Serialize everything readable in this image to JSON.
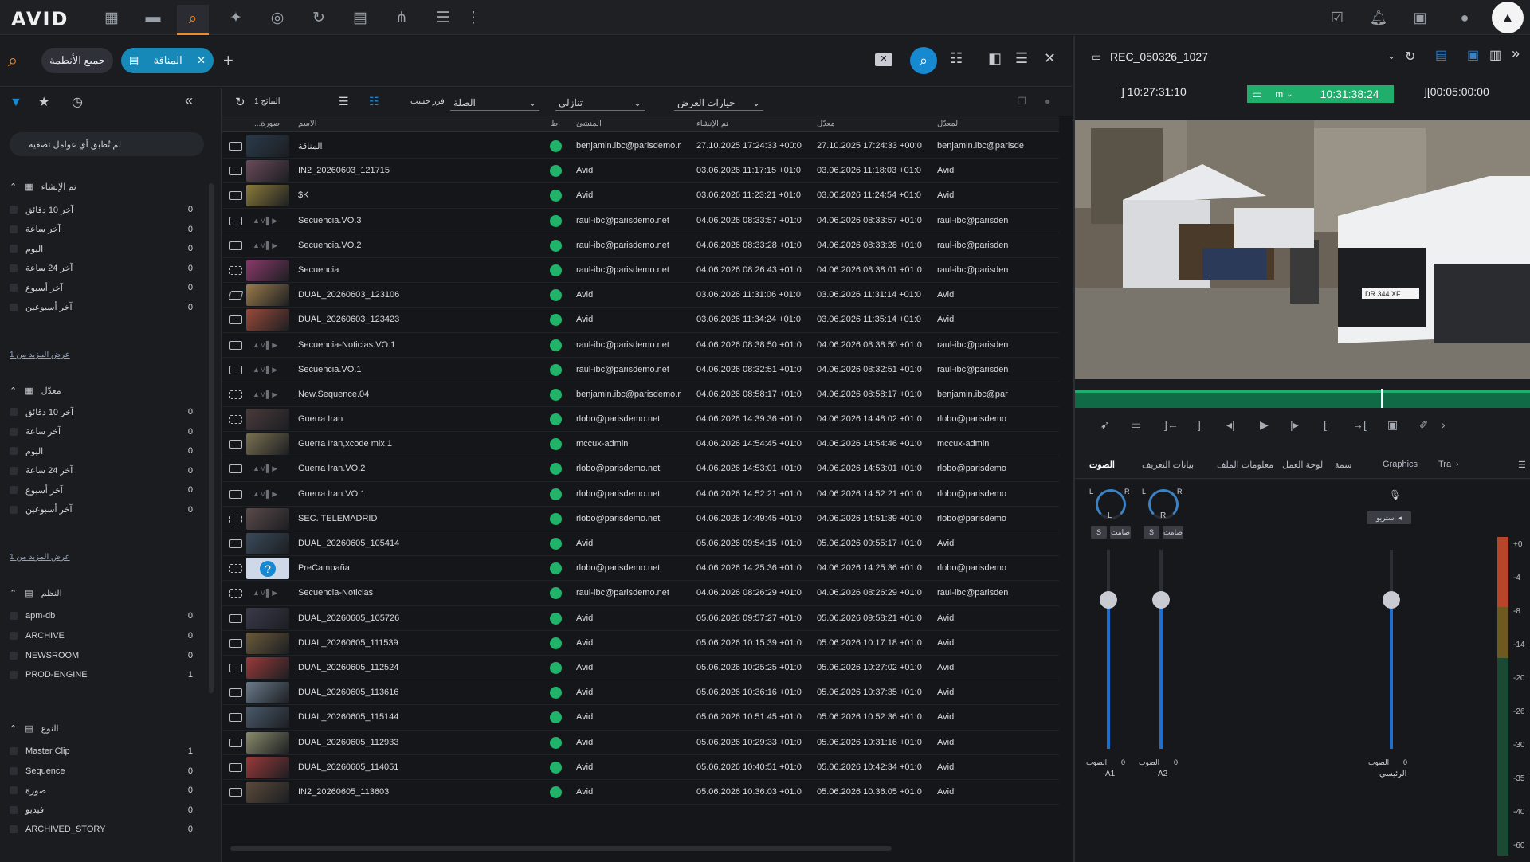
{
  "topbar": {
    "logo": "AVID",
    "icons": [
      "grid-icon",
      "folder-icon",
      "search-icon",
      "pin-icon",
      "target-icon",
      "refresh-icon",
      "tasks-icon",
      "share-icon",
      "list-icon",
      "more-icon"
    ],
    "right_icons": [
      "check-icon",
      "bell-icon",
      "inbox-icon",
      "user-icon"
    ]
  },
  "search": {
    "all_systems": "جميع الأنظمة",
    "tab_label": "المناقة"
  },
  "filters": {
    "no_filter": "لم تُطبق أي عوامل تصفية",
    "created_header": "تم الإنشاء",
    "modified_header": "معدّل",
    "systems_header": "النظم",
    "type_header": "النوع",
    "more_link": "عرض المزيد من 1",
    "created": [
      {
        "label": "آخر 10 دقائق",
        "count": "0"
      },
      {
        "label": "آخر ساعة",
        "count": "0"
      },
      {
        "label": "اليوم",
        "count": "0"
      },
      {
        "label": "آخر 24 ساعة",
        "count": "0"
      },
      {
        "label": "آخر أسبوع",
        "count": "0"
      },
      {
        "label": "آخر أسبوعين",
        "count": "0"
      }
    ],
    "modified": [
      {
        "label": "آخر 10 دقائق",
        "count": "0"
      },
      {
        "label": "آخر ساعة",
        "count": "0"
      },
      {
        "label": "اليوم",
        "count": "0"
      },
      {
        "label": "آخر 24 ساعة",
        "count": "0"
      },
      {
        "label": "آخر أسبوع",
        "count": "0"
      },
      {
        "label": "آخر أسبوعين",
        "count": "0"
      }
    ],
    "systems": [
      {
        "label": "apm-db",
        "count": "0"
      },
      {
        "label": "ARCHIVE",
        "count": "0"
      },
      {
        "label": "NEWSROOM",
        "count": "0"
      },
      {
        "label": "PROD-ENGINE",
        "count": "1"
      }
    ],
    "types": [
      {
        "label": "Master Clip",
        "count": "1"
      },
      {
        "label": "Sequence",
        "count": "0"
      },
      {
        "label": "صورة",
        "count": "0"
      },
      {
        "label": "فيديو",
        "count": "0"
      },
      {
        "label": "ARCHIVED_STORY",
        "count": "0"
      }
    ]
  },
  "results": {
    "count_label": "1 النتائج",
    "sort_by": "فرز حسب",
    "sort_field": "الصلة",
    "order": "تنازلي",
    "view_options": "خيارات العرض",
    "columns": {
      "frames": "...صورة",
      "name": "الاسم",
      "st": "ط.",
      "creator": "المنشئ",
      "created": "تم الإنشاء",
      "modified": "معدّل",
      "modifier": "المعدّل"
    },
    "rows": [
      {
        "type": "clip",
        "thumb": "#2a3a4a",
        "name": "المناقة",
        "creator": "benjamin.ibc@parisdemo.r",
        "created": "27.10.2025 17:24:33 +00:0",
        "modified": "27.10.2025 17:24:33 +00:0",
        "modifier": "benjamin.ibc@parisde"
      },
      {
        "type": "clip",
        "thumb": "#6a4a5a",
        "name": "IN2_20260603_121715",
        "creator": "Avid",
        "created": "03.06.2026 11:17:15 +01:0",
        "modified": "03.06.2026 11:18:03 +01:0",
        "modifier": "Avid"
      },
      {
        "type": "clip",
        "thumb": "#8a7a3a",
        "name": "$K",
        "creator": "Avid",
        "created": "03.06.2026 11:23:21 +01:0",
        "modified": "03.06.2026 11:24:54 +01:0",
        "modifier": "Avid"
      },
      {
        "type": "seq",
        "thumb": "",
        "name": "Secuencia.VO.3",
        "creator": "raul-ibc@parisdemo.net",
        "created": "04.06.2026 08:33:57 +01:0",
        "modified": "04.06.2026 08:33:57 +01:0",
        "modifier": "raul-ibc@parisden"
      },
      {
        "type": "seq",
        "thumb": "",
        "name": "Secuencia.VO.2",
        "creator": "raul-ibc@parisdemo.net",
        "created": "04.06.2026 08:33:28 +01:0",
        "modified": "04.06.2026 08:33:28 +01:0",
        "modifier": "raul-ibc@parisden"
      },
      {
        "type": "grid",
        "thumb": "#8a3a6a",
        "name": "Secuencia",
        "creator": "raul-ibc@parisdemo.net",
        "created": "04.06.2026 08:26:43 +01:0",
        "modified": "04.06.2026 08:38:01 +01:0",
        "modifier": "raul-ibc@parisden"
      },
      {
        "type": "img",
        "thumb": "#9a7a4a",
        "name": "DUAL_20260603_123106",
        "creator": "Avid",
        "created": "03.06.2026 11:31:06 +01:0",
        "modified": "03.06.2026 11:31:14 +01:0",
        "modifier": "Avid"
      },
      {
        "type": "clip",
        "thumb": "#9a4a3a",
        "name": "DUAL_20260603_123423",
        "creator": "Avid",
        "created": "03.06.2026 11:34:24 +01:0",
        "modified": "03.06.2026 11:35:14 +01:0",
        "modifier": "Avid"
      },
      {
        "type": "seq",
        "thumb": "",
        "name": "Secuencia-Noticias.VO.1",
        "creator": "raul-ibc@parisdemo.net",
        "created": "04.06.2026 08:38:50 +01:0",
        "modified": "04.06.2026 08:38:50 +01:0",
        "modifier": "raul-ibc@parisden"
      },
      {
        "type": "seq",
        "thumb": "",
        "name": "Secuencia.VO.1",
        "creator": "raul-ibc@parisdemo.net",
        "created": "04.06.2026 08:32:51 +01:0",
        "modified": "04.06.2026 08:32:51 +01:0",
        "modifier": "raul-ibc@parisden"
      },
      {
        "type": "grid",
        "thumb": "",
        "name": "New.Sequence.04",
        "creator": "benjamin.ibc@parisdemo.r",
        "created": "04.06.2026 08:58:17 +01:0",
        "modified": "04.06.2026 08:58:17 +01:0",
        "modifier": "benjamin.ibc@par"
      },
      {
        "type": "grid",
        "thumb": "#4a3a3a",
        "name": "Guerra Iran",
        "creator": "rlobo@parisdemo.net",
        "created": "04.06.2026 14:39:36 +01:0",
        "modified": "04.06.2026 14:48:02 +01:0",
        "modifier": "rlobo@parisdemo"
      },
      {
        "type": "seq",
        "thumb": "#7a7050",
        "name": "Guerra Iran,xcode mix,1",
        "creator": "mccux-admin",
        "created": "04.06.2026 14:54:45 +01:0",
        "modified": "04.06.2026 14:54:46 +01:0",
        "modifier": "mccux-admin"
      },
      {
        "type": "seq",
        "thumb": "",
        "name": "Guerra Iran.VO.2",
        "creator": "rlobo@parisdemo.net",
        "created": "04.06.2026 14:53:01 +01:0",
        "modified": "04.06.2026 14:53:01 +01:0",
        "modifier": "rlobo@parisdemo"
      },
      {
        "type": "seq",
        "thumb": "",
        "name": "Guerra Iran.VO.1",
        "creator": "rlobo@parisdemo.net",
        "created": "04.06.2026 14:52:21 +01:0",
        "modified": "04.06.2026 14:52:21 +01:0",
        "modifier": "rlobo@parisdemo"
      },
      {
        "type": "grid",
        "thumb": "#5a4a4a",
        "name": "SEC. TELEMADRID",
        "creator": "rlobo@parisdemo.net",
        "created": "04.06.2026 14:49:45 +01:0",
        "modified": "04.06.2026 14:51:39 +01:0",
        "modifier": "rlobo@parisdemo"
      },
      {
        "type": "clip",
        "thumb": "#3a4a5a",
        "name": "DUAL_20260605_105414",
        "creator": "Avid",
        "created": "05.06.2026 09:54:15 +01:0",
        "modified": "05.06.2026 09:55:17 +01:0",
        "modifier": "Avid"
      },
      {
        "type": "grid",
        "thumb": "q",
        "name": "PreCampaña",
        "creator": "rlobo@parisdemo.net",
        "created": "04.06.2026 14:25:36 +01:0",
        "modified": "04.06.2026 14:25:36 +01:0",
        "modifier": "rlobo@parisdemo"
      },
      {
        "type": "grid",
        "thumb": "",
        "name": "Secuencia-Noticias",
        "creator": "raul-ibc@parisdemo.net",
        "created": "04.06.2026 08:26:29 +01:0",
        "modified": "04.06.2026 08:26:29 +01:0",
        "modifier": "raul-ibc@parisden"
      },
      {
        "type": "clip",
        "thumb": "#3a3a4a",
        "name": "DUAL_20260605_105726",
        "creator": "Avid",
        "created": "05.06.2026 09:57:27 +01:0",
        "modified": "05.06.2026 09:58:21 +01:0",
        "modifier": "Avid"
      },
      {
        "type": "clip",
        "thumb": "#6a5a3a",
        "name": "DUAL_20260605_111539",
        "creator": "Avid",
        "created": "05.06.2026 10:15:39 +01:0",
        "modified": "05.06.2026 10:17:18 +01:0",
        "modifier": "Avid"
      },
      {
        "type": "clip",
        "thumb": "#9a3a3a",
        "name": "DUAL_20260605_112524",
        "creator": "Avid",
        "created": "05.06.2026 10:25:25 +01:0",
        "modified": "05.06.2026 10:27:02 +01:0",
        "modifier": "Avid"
      },
      {
        "type": "clip",
        "thumb": "#6a7a8a",
        "name": "DUAL_20260605_113616",
        "creator": "Avid",
        "created": "05.06.2026 10:36:16 +01:0",
        "modified": "05.06.2026 10:37:35 +01:0",
        "modifier": "Avid"
      },
      {
        "type": "clip",
        "thumb": "#4a5a6a",
        "name": "DUAL_20260605_115144",
        "creator": "Avid",
        "created": "05.06.2026 10:51:45 +01:0",
        "modified": "05.06.2026 10:52:36 +01:0",
        "modifier": "Avid"
      },
      {
        "type": "clip",
        "thumb": "#8a8a6a",
        "name": "DUAL_20260605_112933",
        "creator": "Avid",
        "created": "05.06.2026 10:29:33 +01:0",
        "modified": "05.06.2026 10:31:16 +01:0",
        "modifier": "Avid"
      },
      {
        "type": "clip",
        "thumb": "#9a3a3a",
        "name": "DUAL_20260605_114051",
        "creator": "Avid",
        "created": "05.06.2026 10:40:51 +01:0",
        "modified": "05.06.2026 10:42:34 +01:0",
        "modifier": "Avid"
      },
      {
        "type": "clip",
        "thumb": "#5a4a3a",
        "name": "IN2_20260605_113603",
        "creator": "Avid",
        "created": "05.06.2026 10:36:03 +01:0",
        "modified": "05.06.2026 10:36:05 +01:0",
        "modifier": "Avid"
      }
    ]
  },
  "player": {
    "title": "REC_050326_1027",
    "tc_in": "10:27:31:10",
    "tc_mode": "m",
    "tc_current": "10:31:38:24",
    "tc_duration": "00:05:00:00",
    "plate": "DR 344 XF",
    "tabs": [
      "الصوت",
      "بيانات التعريف",
      "معلومات الملف",
      "لوحة العمل",
      "سمة",
      "Graphics",
      "Tra"
    ],
    "ch1": {
      "l": "L",
      "r": "R",
      "knob": "L",
      "solo": "S",
      "mute": "صامت",
      "label": "الصوت",
      "value": "0",
      "track": "A1",
      "level": 0.75
    },
    "ch2": {
      "l": "L",
      "r": "R",
      "knob": "R",
      "solo": "S",
      "mute": "صامت",
      "label": "الصوت",
      "value": "0",
      "track": "A2",
      "level": 0.75
    },
    "master": {
      "mode": "استريو",
      "label": "الصوت",
      "value": "0",
      "track": "الرئيسي",
      "level": 0.75
    },
    "scale": [
      "+0",
      "-4",
      "-8",
      "-14",
      "-20",
      "-26",
      "-30",
      "-35",
      "-40",
      "-60"
    ]
  }
}
